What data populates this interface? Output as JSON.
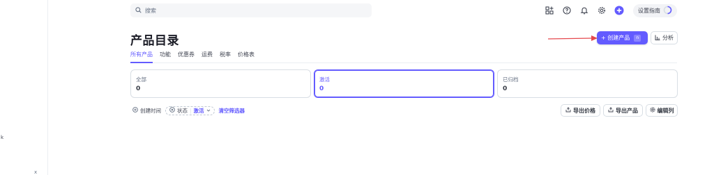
{
  "sidebar_fragments": {
    "k": "k",
    "x": "x"
  },
  "search": {
    "placeholder": "搜索"
  },
  "header": {
    "icons": [
      "apps-icon",
      "help-icon",
      "bell-icon",
      "gear-icon",
      "plus-circle-icon"
    ],
    "setup_guide": "设置指南",
    "accent": "#635bff"
  },
  "page": {
    "title": "产品目录",
    "create_button": "+ 创建产品",
    "create_shortcut": "n",
    "analysis_button": "分析"
  },
  "tabs": [
    {
      "label": "所有产品",
      "active": true
    },
    {
      "label": "功能",
      "active": false
    },
    {
      "label": "优惠券",
      "active": false
    },
    {
      "label": "运费",
      "active": false
    },
    {
      "label": "税率",
      "active": false
    },
    {
      "label": "价格表",
      "active": false
    }
  ],
  "status_cards": [
    {
      "label": "全部",
      "count": "0",
      "active": false
    },
    {
      "label": "激活",
      "count": "0",
      "active": true
    },
    {
      "label": "已归档",
      "count": "0",
      "active": false
    }
  ],
  "filters": {
    "created_time": "创建时间",
    "status_label": "状态",
    "status_value": "激活",
    "clear": "清空筛选器"
  },
  "actions": {
    "export_prices": "导出价格",
    "export_products": "导出产品",
    "edit_columns": "编辑列"
  }
}
